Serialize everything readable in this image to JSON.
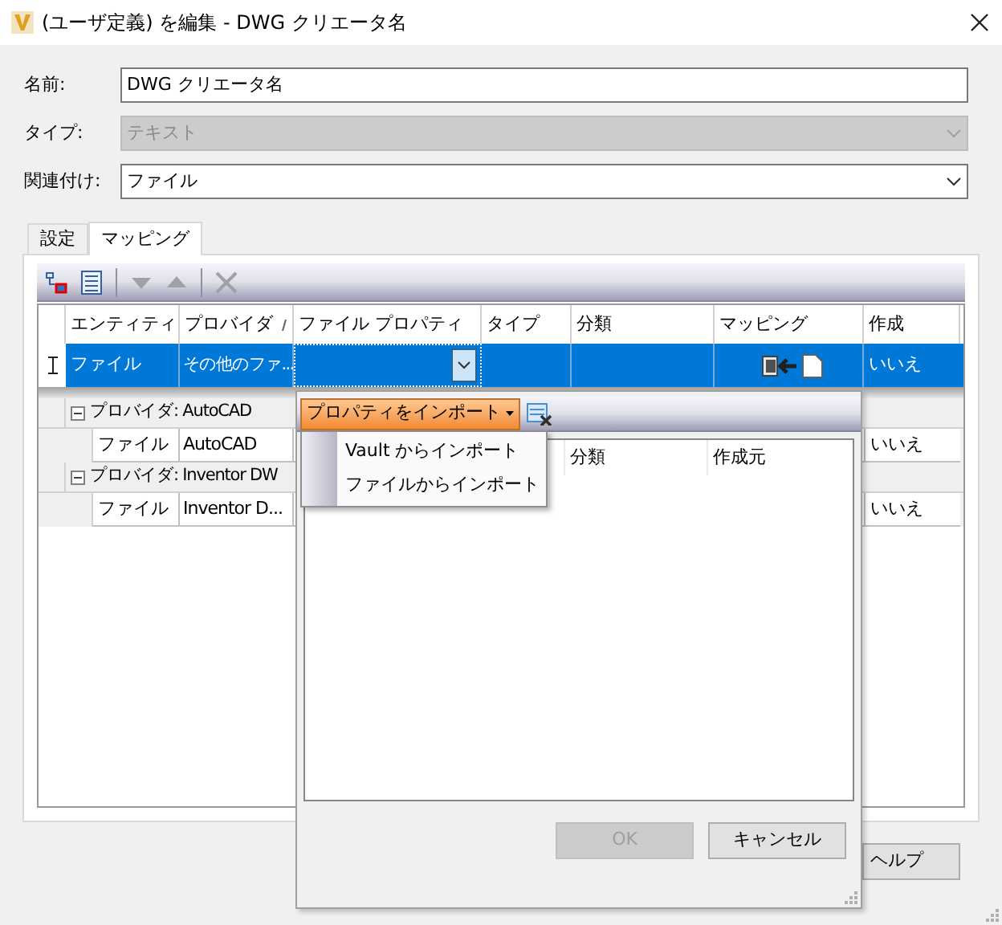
{
  "window": {
    "title": "(ユーザ定義) を編集 - DWG クリエータ名"
  },
  "form": [
    {
      "label": "名前:",
      "value": "DWG クリエータ名",
      "kind": "text",
      "disabled": false
    },
    {
      "label": "タイプ:",
      "value": "テキスト",
      "kind": "select",
      "disabled": true
    },
    {
      "label": "関連付け:",
      "value": "ファイル",
      "kind": "select",
      "disabled": false
    }
  ],
  "tabs": [
    {
      "label": "設定",
      "selected": false
    },
    {
      "label": "マッピング",
      "selected": true
    }
  ],
  "toolbar": [
    {
      "kind": "tree",
      "disabled": false
    },
    {
      "kind": "list",
      "disabled": false
    },
    {
      "kind": "down",
      "disabled": true
    },
    {
      "kind": "up",
      "disabled": true
    },
    {
      "kind": "delete",
      "disabled": true
    }
  ],
  "grid": {
    "columns": [
      "エンティティ",
      "プロバイダ",
      "ファイル プロパティ",
      "タイプ",
      "分類",
      "マッピング",
      "作成"
    ],
    "rows": [
      {
        "entity": "ファイル",
        "provider": "その他のファ...",
        "created": "いいえ",
        "selected": true
      }
    ],
    "groups": [
      {
        "label": "プロバイダ: AutoCAD",
        "expanded": true,
        "rows": [
          {
            "entity": "ファイル",
            "provider": "AutoCAD",
            "created": "いいえ"
          }
        ]
      },
      {
        "label": "プロバイダ: Inventor DW",
        "expanded": true,
        "rows": [
          {
            "entity": "ファイル",
            "provider": "Inventor D...",
            "created": "いいえ"
          }
        ]
      }
    ]
  },
  "popup": {
    "import_button": "プロパティをインポート",
    "menu": [
      "Vault からインポート",
      "ファイルからインポート"
    ],
    "columns": [
      "分類",
      "作成元"
    ],
    "buttons": [
      {
        "label": "OK",
        "disabled": true
      },
      {
        "label": "キャンセル",
        "disabled": false
      }
    ]
  },
  "help_button": "ヘルプ"
}
